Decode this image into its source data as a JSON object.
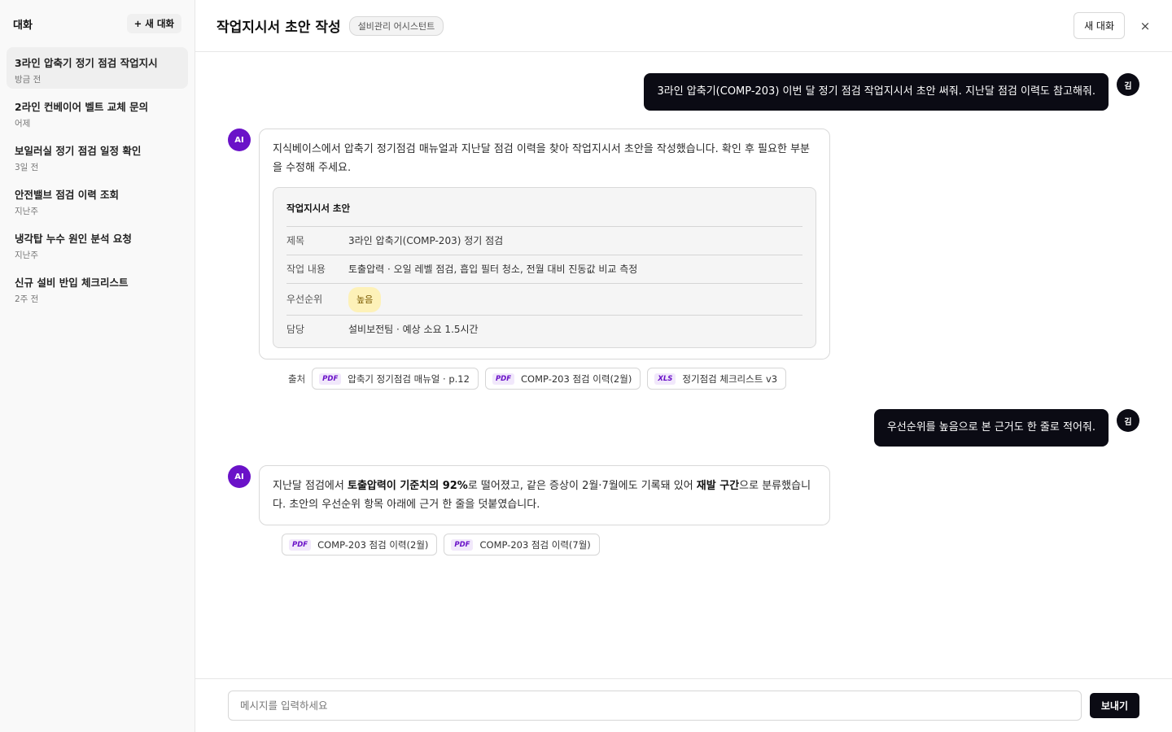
{
  "sidebar": {
    "title": "대화",
    "new_chat_label": "+ 새 대화",
    "items": [
      {
        "title": "3라인 압축기 정기 점검 작업지시",
        "time": "방금 전"
      },
      {
        "title": "2라인 컨베이어 벨트 교체 문의",
        "time": "어제"
      },
      {
        "title": "보일러실 정기 점검 일정 확인",
        "time": "3일 전"
      },
      {
        "title": "안전밸브 점검 이력 조회",
        "time": "지난주"
      },
      {
        "title": "냉각탑 누수 원인 분석 요청",
        "time": "지난주"
      },
      {
        "title": "신규 설비 반입 체크리스트",
        "time": "2주 전"
      }
    ]
  },
  "header": {
    "title": "작업지시서 초안 작성",
    "badge": "설비관리 어시스턴트",
    "new_chat_label": "새 대화",
    "close_glyph": "×"
  },
  "avatars": {
    "user": "김",
    "ai": "AI"
  },
  "messages": {
    "user1": "3라인 압축기(COMP-203) 이번 달 정기 점검 작업지시서 초안 써줘. 지난달 점검 이력도 참고해줘.",
    "ai1": {
      "text": "지식베이스에서 압축기 정기점검 매뉴얼과 지난달 점검 이력을 찾아 작업지시서 초안을 작성했습니다. 확인 후 필요한 부분을 수정해 주세요.",
      "draft": {
        "title": "작업지시서 초안",
        "rows": [
          {
            "key": "제목",
            "value": "3라인 압축기(COMP-203) 정기 점검"
          },
          {
            "key": "작업 내용",
            "value": "토출압력 · 오일 레벨 점검, 흡입 필터 청소, 전월 대비 진동값 비교 측정"
          },
          {
            "key": "우선순위",
            "value": "높음"
          },
          {
            "key": "담당",
            "value": "설비보전팀 · 예상 소요 1.5시간"
          }
        ]
      },
      "sources_label": "출처",
      "sources": [
        {
          "type": "PDF",
          "name": "압축기 정기점검 매뉴얼 · p.12"
        },
        {
          "type": "PDF",
          "name": "COMP-203 점검 이력(2월)"
        },
        {
          "type": "XLS",
          "name": "정기점검 체크리스트 v3"
        }
      ]
    },
    "user2": "우선순위를 높음으로 본 근거도 한 줄로 적어줘.",
    "ai2": {
      "part1": "지난달 점검에서 ",
      "bold1": "토출압력이 기준치의 92%",
      "part2": "로 떨어졌고, 같은 증상이 2월·7월에도 기록돼 있어 ",
      "bold2": "재발 구간",
      "part3": "으로 분류했습니다. 초안의 우선순위 항목 아래에 근거 한 줄을 덧붙였습니다.",
      "sources": [
        {
          "type": "PDF",
          "name": "COMP-203 점검 이력(2월)"
        },
        {
          "type": "PDF",
          "name": "COMP-203 점검 이력(7월)"
        }
      ]
    }
  },
  "composer": {
    "placeholder": "메시지를 입력하세요",
    "send_label": "보내기"
  }
}
